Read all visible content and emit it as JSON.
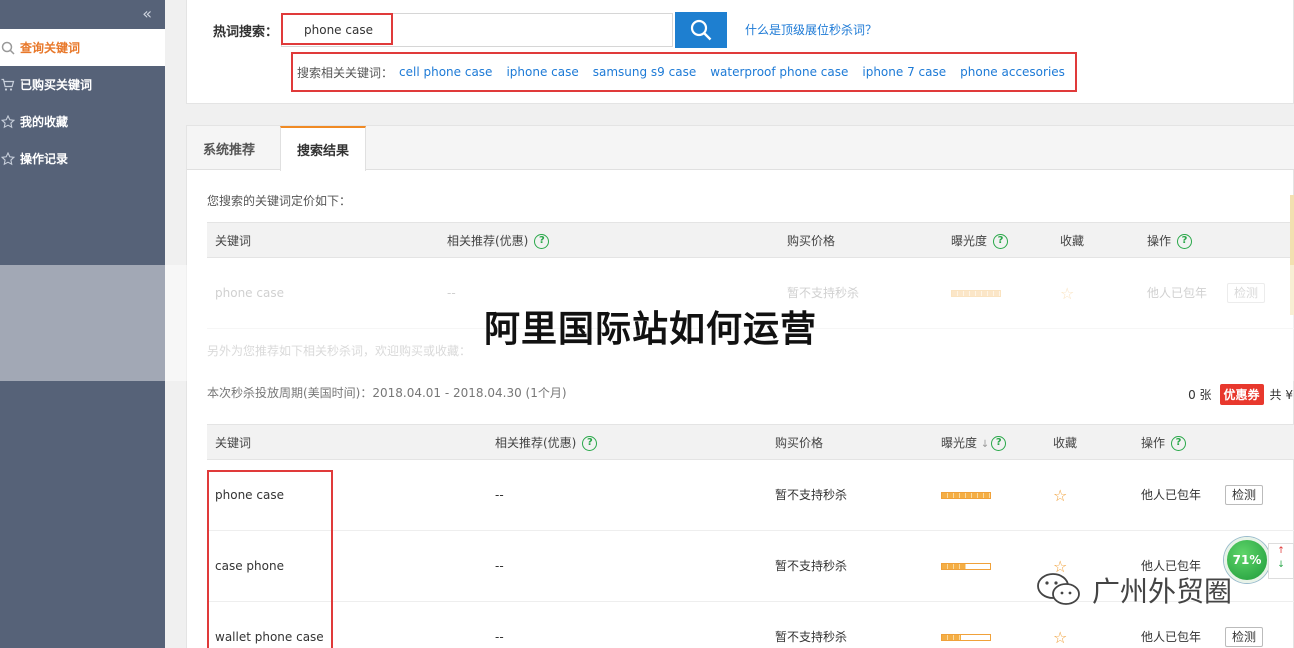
{
  "sidebar": {
    "collapse_glyph": "«",
    "items": [
      {
        "label": "查询关键词",
        "icon": "search-icon",
        "active": true
      },
      {
        "label": "已购买关键词",
        "icon": "cart-icon",
        "active": false
      },
      {
        "label": "我的收藏",
        "icon": "star-icon",
        "active": false
      },
      {
        "label": "操作记录",
        "icon": "record-icon",
        "active": false
      }
    ]
  },
  "search": {
    "label": "热词搜索：",
    "value": "phone case",
    "help_link": "什么是顶级展位秒杀词？",
    "related_label": "搜索相关关键词：",
    "related": [
      "cell phone case",
      "iphone case",
      "samsung s9 case",
      "waterproof phone case",
      "iphone 7 case",
      "phone accesories"
    ]
  },
  "tabs": [
    {
      "label": "系统推荐",
      "active": false
    },
    {
      "label": "搜索结果",
      "active": true
    }
  ],
  "intro": "您搜索的关键词定价如下：",
  "headers": {
    "keyword": "关键词",
    "related": "相关推荐(优惠)",
    "price": "购买价格",
    "exposure": "曝光度",
    "favorite": "收藏",
    "action": "操作",
    "sort_glyph": "↓"
  },
  "priced_row": {
    "keyword": "phone case",
    "related": "--",
    "price": "暂不支持秒杀",
    "exposure": 1.0,
    "status": "他人已包年",
    "action": "检测"
  },
  "note": "另外为您推荐如下相关秒杀词，欢迎购买或收藏：",
  "period": "本次秒杀投放周期(美国时间)：2018.04.01 - 2018.04.30 (1个月)",
  "coupon": {
    "count": "0 张",
    "label": "优惠券",
    "total": "共 ¥"
  },
  "rows": [
    {
      "keyword": "phone case",
      "related": "--",
      "price": "暂不支持秒杀",
      "exposure": 1.0,
      "status": "他人已包年",
      "action": "检测"
    },
    {
      "keyword": "case phone",
      "related": "--",
      "price": "暂不支持秒杀",
      "exposure": 0.5,
      "status": "他人已包年",
      "action": ""
    },
    {
      "keyword": "wallet phone case",
      "related": "--",
      "price": "暂不支持秒杀",
      "exposure": 0.4,
      "status": "他人已包年",
      "action": "检测"
    }
  ],
  "overlay_title": "阿里国际站如何运营",
  "badge": {
    "percent": "71%",
    "up": "↑",
    "down": "↓"
  },
  "watermark": "广州外贸圈",
  "colors": {
    "sidebar": "#566278",
    "accent": "#e8782a",
    "link": "#1d7ad6",
    "search_button": "#1e7fd0",
    "highlight_box": "#e03a3a",
    "coupon": "#e8382d"
  }
}
